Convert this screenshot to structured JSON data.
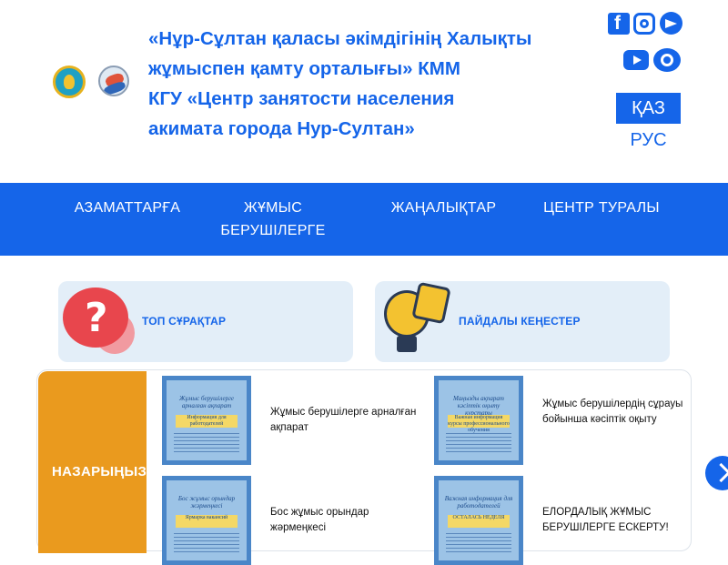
{
  "header": {
    "org_title_lines": [
      "«Нұр-Сұлтан қаласы әкімдігінің Халықты",
      "жұмыспен қамту орталығы» КММ",
      "КГУ «Центр занятости населения",
      "акимата города Нур-Султан»"
    ],
    "logos": [
      "emblem-logo",
      "globe-logo"
    ],
    "social_icons": [
      "facebook-icon",
      "instagram-icon",
      "telegram-icon",
      "youtube-icon",
      "eye-icon"
    ],
    "languages": {
      "kz": "ҚАЗ",
      "ru": "РУС"
    }
  },
  "nav": {
    "items": [
      {
        "label": "АЗАМАТТАРҒА"
      },
      {
        "label": "ЖҰМЫС БЕРУШІЛЕРГЕ"
      },
      {
        "label": "ЖАҢАЛЫҚТАР"
      },
      {
        "label": "ЦЕНТР ТУРАЛЫ"
      }
    ]
  },
  "quick_links": [
    {
      "label": "ТОП СҰРАҚТАР",
      "icon": "question-bubble-icon"
    },
    {
      "label": "ПАЙДАЛЫ КЕҢЕСТЕР",
      "icon": "lightbulb-puzzle-icon"
    }
  ],
  "attention": {
    "label": "НАЗАРЫҢЫЗҒА"
  },
  "news": [
    {
      "title": "Жұмыс берушілерге арналған ақпарат",
      "thumb_title": "Жұмыс берушілерге арналған ақпарат",
      "thumb_sub": "Информация для работодателей"
    },
    {
      "title": "Жұмыс берушілердің сұрауы бойынша кәсіптік оқыту",
      "thumb_title": "Маңызды ақпарат кәсіптік оқыту курстары",
      "thumb_sub": "Важная информация курсы профессионального обучения"
    },
    {
      "title": "Бос жұмыс орындар жәрмеңкесі",
      "thumb_title": "Бос жұмыс орындар жәрмеңкесі",
      "thumb_sub": "Ярмарка вакансий"
    },
    {
      "title": "ЕЛОРДАЛЫҚ ЖҰМЫС БЕРУШІЛЕРГЕ ЕСКЕРТУ!",
      "thumb_title": "Важная информация для работодателей",
      "thumb_sub": "ОСТАЛАСЬ НЕДЕЛЯ"
    }
  ],
  "colors": {
    "brand_blue": "#1565e9",
    "attention_orange": "#ea9a1e",
    "card_bg": "#e3eef8"
  }
}
